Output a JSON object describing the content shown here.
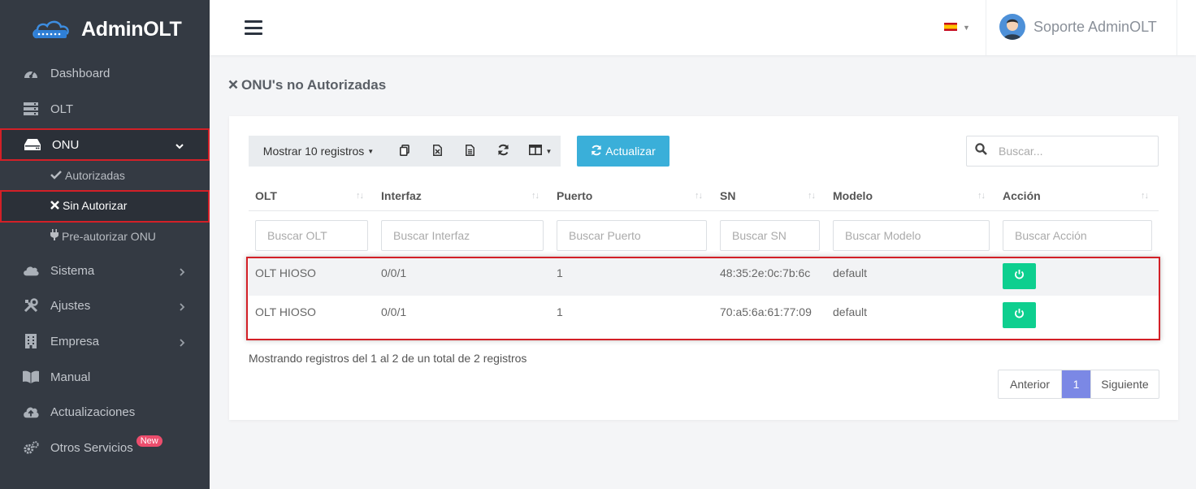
{
  "brand": {
    "name": "AdminOLT"
  },
  "sidebar": {
    "items": [
      {
        "label": "Dashboard",
        "icon": "dashboard-icon"
      },
      {
        "label": "OLT",
        "icon": "server-icon"
      },
      {
        "label": "ONU",
        "icon": "hdd-icon"
      },
      {
        "label": "Sistema",
        "icon": "cloud-icon"
      },
      {
        "label": "Ajustes",
        "icon": "tools-icon"
      },
      {
        "label": "Empresa",
        "icon": "building-icon"
      },
      {
        "label": "Manual",
        "icon": "book-icon"
      },
      {
        "label": "Actualizaciones",
        "icon": "cloud-upload-icon"
      },
      {
        "label": "Otros Servicios",
        "icon": "cogs-icon"
      }
    ],
    "new_badge": "New",
    "subitems": [
      {
        "label": "Autorizadas",
        "icon": "check-icon"
      },
      {
        "label": "Sin Autorizar",
        "icon": "times-icon"
      },
      {
        "label": "Pre-autorizar ONU",
        "icon": "plug-icon"
      }
    ]
  },
  "topbar": {
    "user_name": "Soporte AdminOLT",
    "language_flag": "es-flag-icon"
  },
  "page": {
    "title": "ONU's no Autorizadas"
  },
  "toolbar": {
    "show_records": "Mostrar 10 registros",
    "update_label": "Actualizar"
  },
  "search": {
    "placeholder": "Buscar..."
  },
  "table": {
    "columns": [
      "OLT",
      "Interfaz",
      "Puerto",
      "SN",
      "Modelo",
      "Acción"
    ],
    "filters": [
      "Buscar OLT",
      "Buscar Interfaz",
      "Buscar Puerto",
      "Buscar SN",
      "Buscar Modelo",
      "Buscar Acción"
    ],
    "rows": [
      {
        "olt": "OLT HIOSO",
        "interfaz": "0/0/1",
        "puerto": "1",
        "sn": "48:35:2e:0c:7b:6c",
        "modelo": "default"
      },
      {
        "olt": "OLT HIOSO",
        "interfaz": "0/0/1",
        "puerto": "1",
        "sn": "70:a5:6a:61:77:09",
        "modelo": "default"
      }
    ],
    "info": "Mostrando registros del 1 al 2 de un total de 2 registros"
  },
  "pagination": {
    "prev": "Anterior",
    "current": "1",
    "next": "Siguiente"
  },
  "colors": {
    "sidebar": "#343a43",
    "accent": "#3aafd9",
    "power": "#0ecf8f",
    "highlight": "#d32027",
    "page_active": "#7b88e5"
  }
}
